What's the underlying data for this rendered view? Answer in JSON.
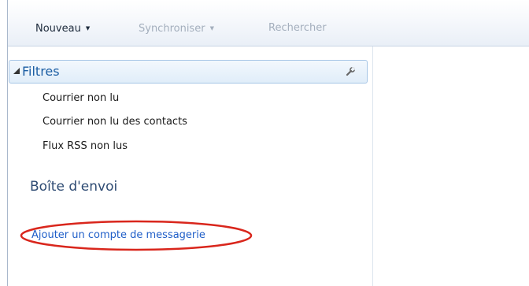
{
  "toolbar": {
    "new_label": "Nouveau",
    "sync_label": "Synchroniser",
    "search_label": "Rechercher"
  },
  "sidebar": {
    "filters_label": "Filtres",
    "filter_items": [
      {
        "label": "Courrier non lu"
      },
      {
        "label": "Courrier non lu des contacts"
      },
      {
        "label": "Flux RSS non lus"
      }
    ],
    "outbox_label": "Boîte d'envoi",
    "add_account_label": "Ajouter un compte de messagerie"
  },
  "icons": {
    "filters_expand": "triangle-expanded-icon",
    "filters_settings": "wrench-icon",
    "dropdown": "chevron-down-icon"
  },
  "colors": {
    "link": "#1f5ec8",
    "header_text": "#1d5fa4",
    "highlight_ellipse": "#d9261c"
  }
}
